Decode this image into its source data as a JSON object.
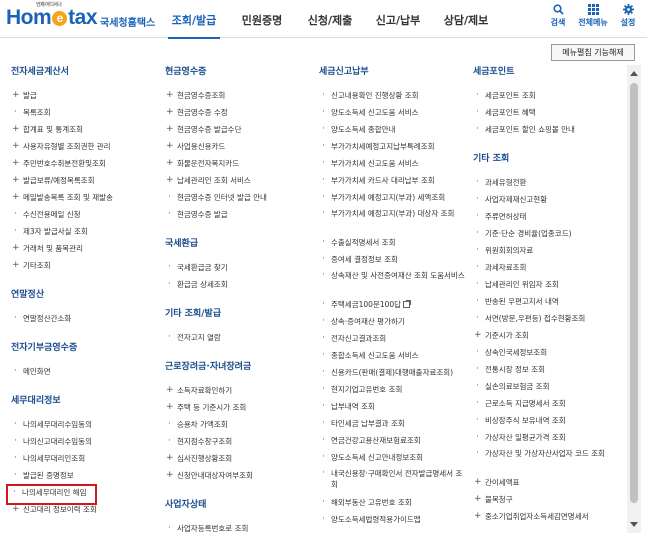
{
  "logo": {
    "mark_pre": "Hom",
    "mark_e": "e",
    "mark_post": "tax",
    "tagline": "언제 어디서나",
    "sub": "국세청홈택스"
  },
  "gnb": [
    "조회/발급",
    "민원증명",
    "신청/제출",
    "신고/납부",
    "상담/제보"
  ],
  "util": {
    "search": "검색",
    "allmenu": "전체메뉴",
    "settings": "설정"
  },
  "menu_toggle": "메뉴펼침 기능해제",
  "col1": [
    {
      "title": "전자세금계산서",
      "items": [
        {
          "t": "발급",
          "plus": true
        },
        {
          "t": "목록조회",
          "plus": false
        },
        {
          "t": "합계표 및 통계조회",
          "plus": true
        },
        {
          "t": "사용자유형별 조회권한 관리",
          "plus": true
        },
        {
          "t": "주민번호수취분전환및조회",
          "plus": true
        },
        {
          "t": "발급보류/예정목록조회",
          "plus": true
        },
        {
          "t": "메일발송목록 조회 및 재발송",
          "plus": true
        },
        {
          "t": "수신전용메일 신청",
          "plus": false
        },
        {
          "t": "제3자 발급사실 조회",
          "plus": false
        },
        {
          "t": "거래처 및 품목관리",
          "plus": true
        },
        {
          "t": "기타조회",
          "plus": true
        }
      ]
    },
    {
      "title": "연말정산",
      "items": [
        {
          "t": "연말정산간소화",
          "plus": false
        }
      ]
    },
    {
      "title": "전자기부금영수증",
      "items": [
        {
          "t": "메인화면",
          "plus": false
        }
      ]
    },
    {
      "title": "세무대리정보",
      "items": [
        {
          "t": "나의세무대리수임동의",
          "plus": false
        },
        {
          "t": "나의신고대리수임동의",
          "plus": false
        },
        {
          "t": "나의세무대리인조회",
          "plus": false
        },
        {
          "t": "발급된 증명정보",
          "plus": false
        },
        {
          "t": "나의세무대리인 해임",
          "plus": false,
          "highlight": true
        },
        {
          "t": "신고대리 정보이력 조회",
          "plus": true
        }
      ]
    }
  ],
  "col2": [
    {
      "title": "현금영수증",
      "items": [
        {
          "t": "현금영수증조회",
          "plus": true
        },
        {
          "t": "현금영수증 수정",
          "plus": true
        },
        {
          "t": "현금영수증 발급수단",
          "plus": true
        },
        {
          "t": "사업용신용카드",
          "plus": true
        },
        {
          "t": "화물운전자복지카드",
          "plus": true
        },
        {
          "t": "납세관리인 조회 서비스",
          "plus": true
        },
        {
          "t": "현금영수증 인터넷 발급 안내",
          "plus": false
        },
        {
          "t": "현금영수증 발급",
          "plus": false
        }
      ]
    },
    {
      "title": "국세환급",
      "items": [
        {
          "t": "국세환급금 찾기",
          "plus": false
        },
        {
          "t": "환급금 상세조회",
          "plus": false
        }
      ]
    },
    {
      "title": "기타 조회/발급",
      "items": [
        {
          "t": "전자고지 열람",
          "plus": false
        }
      ]
    },
    {
      "title": "근로장려금·자녀장려금",
      "items": [
        {
          "t": "소득자료확인하기",
          "plus": true
        },
        {
          "t": "주택 등 기준시가 조회",
          "plus": true
        },
        {
          "t": "승용차 가액조회",
          "plus": false
        },
        {
          "t": "현지점수창구조회",
          "plus": false
        },
        {
          "t": "심사진행상황조회",
          "plus": true
        },
        {
          "t": "신청안내대상자여부조회",
          "plus": true
        }
      ]
    },
    {
      "title": "사업자상태",
      "items": [
        {
          "t": "사업자등록번호로 조회",
          "plus": false
        }
      ]
    }
  ],
  "col3": [
    {
      "title": "세금신고납부",
      "items": [
        {
          "t": "신고내용확인 진행상황 조회",
          "plus": false
        },
        {
          "t": "양도소득세 신고도움 서비스",
          "plus": false
        },
        {
          "t": "양도소득세 종합안내",
          "plus": false
        },
        {
          "t": "부가가치세예정고지납부특례조회",
          "plus": false
        },
        {
          "t": "부가가치세 신고도움 서비스",
          "plus": false
        },
        {
          "t": "부가가치세 카드사 대리납부 조회",
          "plus": false
        },
        {
          "t": "부가가치세 예정고지(부과) 세액조회",
          "plus": false
        },
        {
          "t": "부가가치세 예정고지(부과) 대상자 조회",
          "plus": false,
          "two": true
        },
        {
          "t": "수출실적명세서 조회",
          "plus": false
        },
        {
          "t": "증여세 결정정보 조회",
          "plus": false
        },
        {
          "t": "상속재산 및 사전증여재산 조회 도움서비스",
          "plus": false,
          "two": true
        },
        {
          "t": "주택세금100문100답",
          "plus": false,
          "ext": true
        },
        {
          "t": "상속·증여재산 평가하기",
          "plus": false
        },
        {
          "t": "전자신고결과조회",
          "plus": false
        },
        {
          "t": "종합소득세 신고도움 서비스",
          "plus": false
        },
        {
          "t": "신용카드(판매(결제)대행매출자료조회)",
          "plus": false
        },
        {
          "t": "현지기업고유번호 조회",
          "plus": false
        },
        {
          "t": "납부내역 조회",
          "plus": false
        },
        {
          "t": "타인세금 납부결과 조회",
          "plus": false
        },
        {
          "t": "연금건강고용산재보험료조회",
          "plus": false
        },
        {
          "t": "양도소득세 신고안내정보조회",
          "plus": false
        },
        {
          "t": "내국신용장·구매확인서 전자발급명세서 조회",
          "plus": false,
          "two": true
        },
        {
          "t": "해외부동산 고유번호 조회",
          "plus": false
        },
        {
          "t": "양도소득세법령적용가이드맵",
          "plus": false
        }
      ]
    }
  ],
  "col4": [
    {
      "title": "세금포인트",
      "items": [
        {
          "t": "세금포인트 조회",
          "plus": false
        },
        {
          "t": "세금포인트 혜택",
          "plus": false
        },
        {
          "t": "세금포인트 할인 쇼핑몰 안내",
          "plus": false
        }
      ]
    },
    {
      "title": "기타 조회",
      "items": [
        {
          "t": "과세유형전환",
          "plus": false
        },
        {
          "t": "사업자제재신고현황",
          "plus": false
        },
        {
          "t": "주류면허상태",
          "plus": false
        },
        {
          "t": "기준·단순 경비율(업종코드)",
          "plus": false
        },
        {
          "t": "위원회회의자료",
          "plus": false
        },
        {
          "t": "과세자료조회",
          "plus": false
        },
        {
          "t": "납세관리인 위임자 조회",
          "plus": false
        },
        {
          "t": "반송된 우편고지서 내역",
          "plus": false
        },
        {
          "t": "서면(방문,우편등) 접수현황조회",
          "plus": false
        },
        {
          "t": "기준시가 조회",
          "plus": true
        },
        {
          "t": "상속인국세정보조회",
          "plus": false
        },
        {
          "t": "전통시장 정보 조회",
          "plus": false
        },
        {
          "t": "실손의료보험금 조회",
          "plus": false
        },
        {
          "t": "근로소득 지급명세서 조회",
          "plus": false
        },
        {
          "t": "비상장주식 보유내역 조회",
          "plus": false
        },
        {
          "t": "가상자산 일평균가격 조회",
          "plus": false
        },
        {
          "t": "가상자산 및 가상자산사업자 코드 조회",
          "plus": false,
          "two": true
        },
        {
          "t": "간이세액표",
          "plus": true
        },
        {
          "t": "불복청구",
          "plus": true
        },
        {
          "t": "중소기업취업자소득세감면명세서",
          "plus": true
        }
      ]
    }
  ]
}
